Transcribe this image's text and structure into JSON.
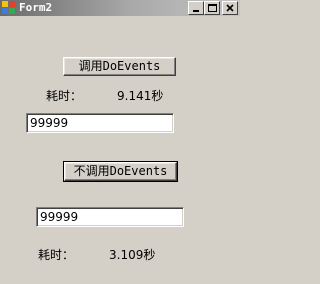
{
  "window": {
    "title": "Form2"
  },
  "controls": {
    "minimize_icon": "minimize-icon",
    "maximize_icon": "maximize-icon",
    "close_icon": "close-icon"
  },
  "section1": {
    "button_label": "调用DoEvents",
    "elapsed_label": "耗时：",
    "elapsed_value": "9.141秒",
    "textbox_value": "99999"
  },
  "section2": {
    "button_label": "不调用DoEvents",
    "textbox_value": "99999",
    "elapsed_label": "耗时：",
    "elapsed_value": "3.109秒"
  }
}
